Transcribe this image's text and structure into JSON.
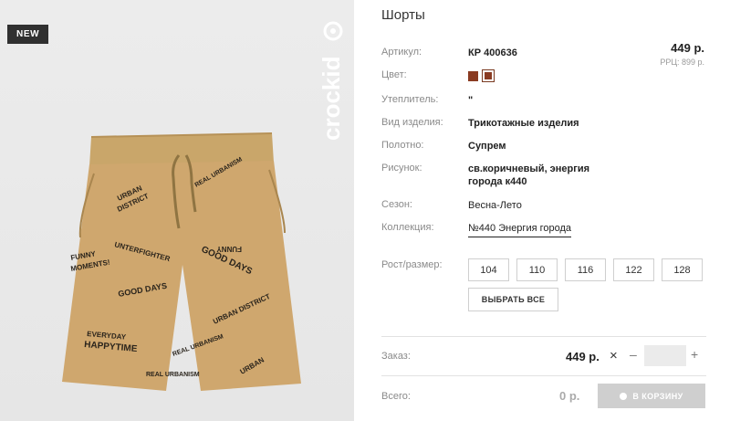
{
  "product": {
    "badge": "NEW",
    "brand_watermark": "crockid",
    "title": "Шорты",
    "price": "449 р.",
    "rrp": "РРЦ: 899 р."
  },
  "attributes": {
    "article_label": "Артикул:",
    "article_value": "КР 400636",
    "color_label": "Цвет:",
    "color_swatches": [
      "#8a3b22",
      "#8a3b22"
    ],
    "insulation_label": "Утеплитель:",
    "insulation_value": "\"",
    "type_label": "Вид изделия:",
    "type_value": "Трикотажные изделия",
    "fabric_label": "Полотно:",
    "fabric_value": "Супрем",
    "pattern_label": "Рисунок:",
    "pattern_value_line1": "св.коричневый, энергия",
    "pattern_value_line2": "города к440",
    "season_label": "Сезон:",
    "season_value": "Весна-Лето",
    "collection_label": "Коллекция:",
    "collection_value": "№440 Энергия города"
  },
  "sizes": {
    "label": "Рост/размер:",
    "options": [
      "104",
      "110",
      "116",
      "122",
      "128"
    ],
    "select_all": "ВЫБРАТЬ ВСЕ"
  },
  "order": {
    "label": "Заказ:",
    "price": "449 р.",
    "multiply": "×",
    "minus": "–",
    "plus": "+",
    "quantity": ""
  },
  "total": {
    "label": "Всего:",
    "price": "0 р.",
    "cart_button": "В КОРЗИНУ"
  }
}
